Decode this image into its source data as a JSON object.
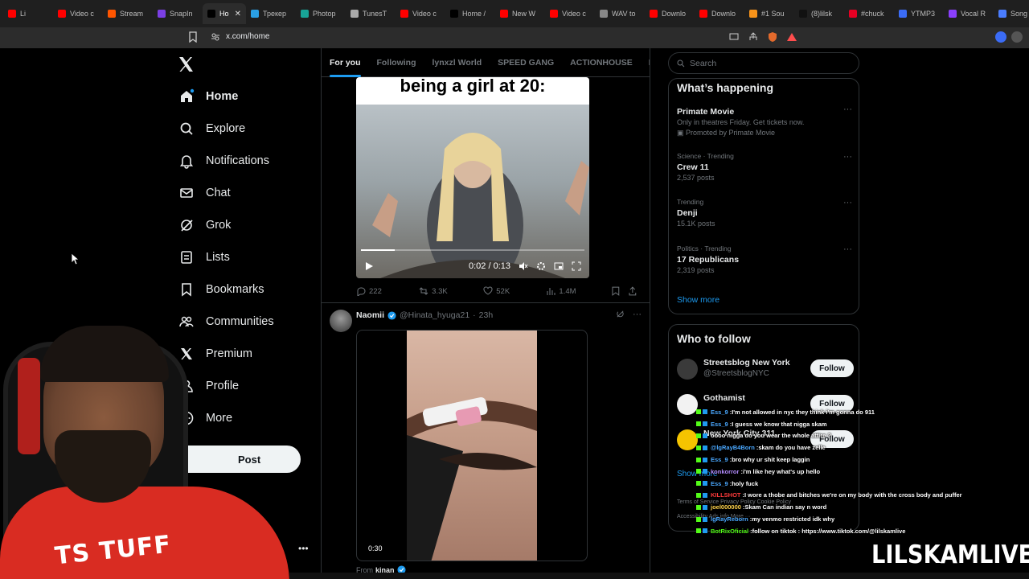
{
  "browser": {
    "tabs": [
      {
        "label": "Li",
        "icon": "youtube-icon",
        "color": "#ff0000"
      },
      {
        "label": "Video c",
        "icon": "youtube-icon",
        "color": "#ff0000"
      },
      {
        "label": "Stream",
        "icon": "soundcloud-icon",
        "color": "#ff5500"
      },
      {
        "label": "SnapIn",
        "icon": "snapinsta-icon",
        "color": "#7b3fe4"
      },
      {
        "label": "Ho",
        "icon": "x-icon",
        "color": "#000000",
        "active": true
      },
      {
        "label": "Трекер",
        "icon": "tracker-icon",
        "color": "#2aa0e5"
      },
      {
        "label": "Photop",
        "icon": "photopea-icon",
        "color": "#18a497"
      },
      {
        "label": "TunesT",
        "icon": "tunes-icon",
        "color": "#aaaaaa"
      },
      {
        "label": "Video c",
        "icon": "youtube-icon",
        "color": "#ff0000"
      },
      {
        "label": "Home /",
        "icon": "x-icon",
        "color": "#000000"
      },
      {
        "label": "New W",
        "icon": "youtube-icon",
        "color": "#ff0000"
      },
      {
        "label": "Video c",
        "icon": "youtube-icon",
        "color": "#ff0000"
      },
      {
        "label": "WAV to",
        "icon": "cloud-icon",
        "color": "#888888"
      },
      {
        "label": "Downlo",
        "icon": "youtube-icon",
        "color": "#ff0000"
      },
      {
        "label": "Downlo",
        "icon": "youtube-icon",
        "color": "#ff0000"
      },
      {
        "label": "#1 Sou",
        "icon": "sound-icon",
        "color": "#f7931a"
      },
      {
        "label": "(8)lilsk",
        "icon": "tiktok-icon",
        "color": "#111111"
      },
      {
        "label": "#chuck",
        "icon": "pinterest-icon",
        "color": "#e60023"
      },
      {
        "label": "YTMP3",
        "icon": "ytmp3-icon",
        "color": "#3b6cf6"
      },
      {
        "label": "Vocal R",
        "icon": "vocal-icon",
        "color": "#8a3ffc"
      },
      {
        "label": "Song K",
        "icon": "song-icon",
        "color": "#4a7dff"
      }
    ],
    "active_tab_close": "✕",
    "url": "x.com/home"
  },
  "nav": {
    "items": [
      {
        "label": "Home",
        "icon": "home-icon",
        "bold": true
      },
      {
        "label": "Explore",
        "icon": "search-icon"
      },
      {
        "label": "Notifications",
        "icon": "bell-icon"
      },
      {
        "label": "Chat",
        "icon": "mail-icon"
      },
      {
        "label": "Grok",
        "icon": "grok-icon"
      },
      {
        "label": "Lists",
        "icon": "list-icon"
      },
      {
        "label": "Bookmarks",
        "icon": "bookmark-icon"
      },
      {
        "label": "Communities",
        "icon": "people-icon"
      },
      {
        "label": "Premium",
        "icon": "x-icon"
      },
      {
        "label": "Profile",
        "icon": "person-icon"
      },
      {
        "label": "More",
        "icon": "more-circle-icon"
      }
    ],
    "post_label": "Post"
  },
  "feed": {
    "tabs": [
      "For you",
      "Following",
      "lynxzl World",
      "SPEED GANG",
      "ACTIONHOUSE",
      "B"
    ],
    "tweet1": {
      "caption": "being a girl at 20:",
      "time": "0:02 / 0:13",
      "progress": 0.15,
      "replies": "222",
      "reposts": "3.3K",
      "likes": "52K",
      "views": "1.4M"
    },
    "tweet2": {
      "name": "Naomii",
      "handle": "@Hinata_hyuga21",
      "time": "23h",
      "duration": "0:30",
      "from_prefix": "From",
      "from_name": "kinan"
    }
  },
  "search": {
    "placeholder": "Search"
  },
  "trends": {
    "title": "What’s happening",
    "items": [
      {
        "meta": "",
        "title": "Primate Movie",
        "sub": "Only in theatres Friday. Get tickets now.",
        "promo": "Promoted by Primate Movie"
      },
      {
        "meta": "Science · Trending",
        "title": "Crew 11",
        "sub": "2,537 posts"
      },
      {
        "meta": "Trending",
        "title": "Denji",
        "sub": "15.1K posts"
      },
      {
        "meta": "Politics · Trending",
        "title": "17 Republicans",
        "sub": "2,319 posts"
      }
    ],
    "show_more": "Show more"
  },
  "who_to_follow": {
    "title": "Who to follow",
    "items": [
      {
        "name": "Streetsblog New York",
        "handle": "@StreetsblogNYC",
        "button": "Follow",
        "avatar_color": "#3a3a3a"
      },
      {
        "name": "Gothamist",
        "handle": "",
        "button": "Follow",
        "avatar_color": "#f2f2f2"
      },
      {
        "name": "New York City 311",
        "handle": "",
        "button": "Follow",
        "avatar_color": "#f5c400"
      }
    ],
    "show_more": "Show more",
    "footer1": "Terms of Service   Privacy Policy   Cookie Policy",
    "footer2": "Accessibility   Ads info   More ···"
  },
  "chat": [
    {
      "user": "Ess_9",
      "user_color": "#4aa8ff",
      "msg": "I'm not allowed in nyc they think i'm gonna do 911"
    },
    {
      "user": "Ess_9",
      "user_color": "#4aa8ff",
      "msg": "I guess we know that nigga skam"
    },
    {
      "user": "",
      "user_color": "#ff3b3b",
      "msg": "oooo nigga do you wear the whole attire ?"
    },
    {
      "user": "@lgRayB4Born",
      "user_color": "#4aa8ff",
      "msg": "skam do you have zelle"
    },
    {
      "user": "Ess_9",
      "user_color": "#4aa8ff",
      "msg": "bro why ur shit keep laggin"
    },
    {
      "user": "konkorror",
      "user_color": "#b48cff",
      "msg": "i'm like hey what's up hello"
    },
    {
      "user": "Ess_9",
      "user_color": "#4aa8ff",
      "msg": "holy fuck"
    },
    {
      "user": "KILLSHOT",
      "user_color": "#ff3b3b",
      "msg": "I wore a thobe and bitches we're on my body with the cross body and puffer"
    },
    {
      "user": "joel000000",
      "user_color": "#ffd24a",
      "msg": "Skam Can indian say n word"
    },
    {
      "user": "lgRayReborn",
      "user_color": "#4aa8ff",
      "msg": "my venmo restricted idk why"
    },
    {
      "user": "BotRixOficial",
      "user_color": "#53fc18",
      "msg": "follow on tiktok : https://www.tiktok.com/@lilskamlive"
    }
  ],
  "webcam": {
    "shirt_text": "TS TUFF"
  },
  "watermark": "LILSKAMLIVE"
}
